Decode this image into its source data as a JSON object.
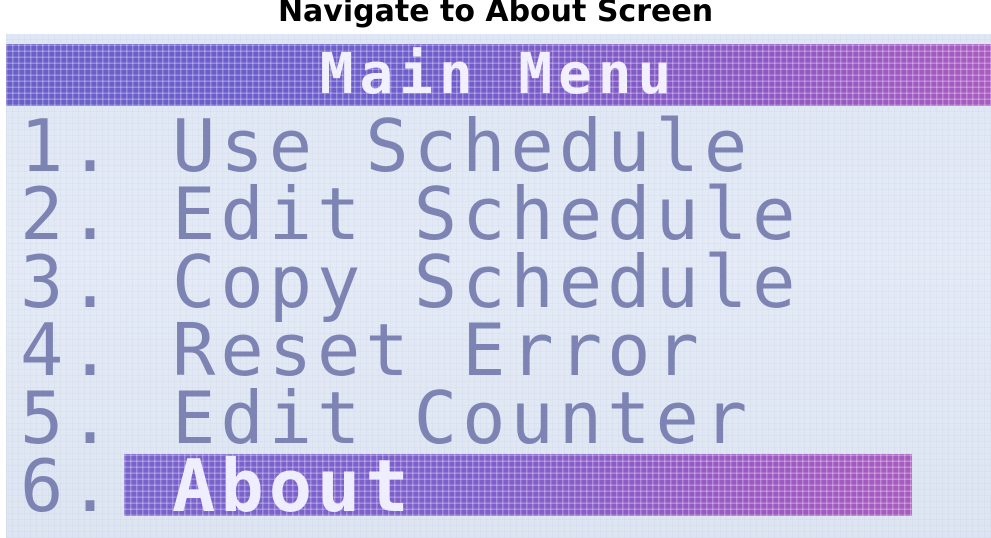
{
  "caption": "Navigate to About Screen",
  "screen": {
    "title": "Main Menu",
    "selected_index": 5,
    "colors": {
      "background": "#e2e9f5",
      "text": "#7d84b4",
      "highlight": "#7a62cb",
      "highlight_text": "#efeefe"
    },
    "items": [
      {
        "number": "1.",
        "label": "Use Schedule"
      },
      {
        "number": "2.",
        "label": "Edit Schedule"
      },
      {
        "number": "3.",
        "label": "Copy Schedule"
      },
      {
        "number": "4.",
        "label": "Reset Error"
      },
      {
        "number": "5.",
        "label": "Edit Counter"
      },
      {
        "number": "6.",
        "label": "About"
      }
    ]
  }
}
